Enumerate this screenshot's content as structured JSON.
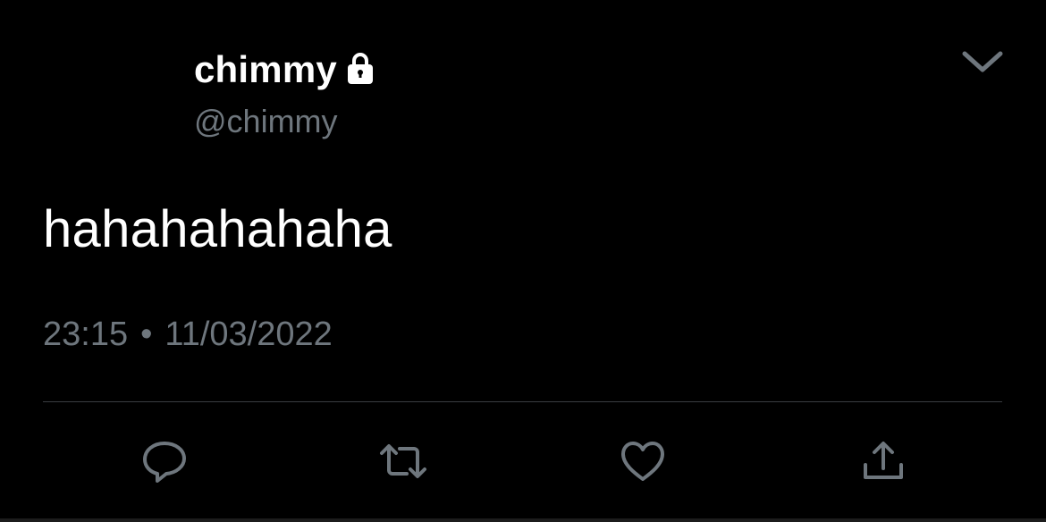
{
  "tweet": {
    "display_name": "chimmy",
    "handle": "@chimmy",
    "text": "hahahahahaha",
    "time": "23:15",
    "separator": "•",
    "date": "11/03/2022",
    "protected": true
  },
  "icons": {
    "lock": "lock-icon",
    "more": "chevron-down-icon",
    "reply": "reply-icon",
    "retweet": "retweet-icon",
    "like": "heart-icon",
    "share": "share-icon"
  },
  "colors": {
    "background": "#000000",
    "primary_text": "#ffffff",
    "secondary_text": "#6e767d",
    "divider": "#3a3d41"
  }
}
